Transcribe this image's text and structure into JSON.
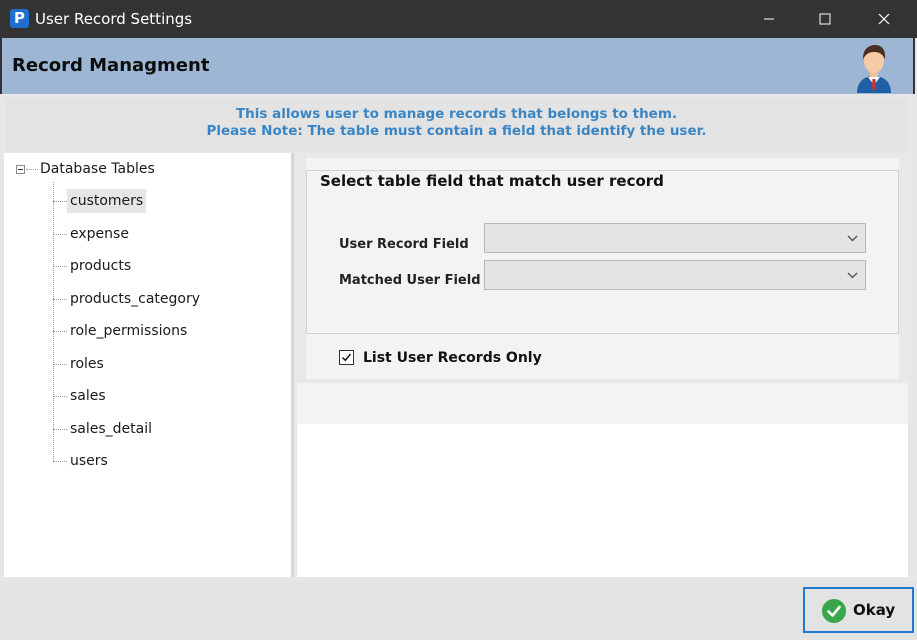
{
  "window": {
    "title": "User Record Settings",
    "app_icon_letter": "P"
  },
  "header": {
    "title": "Record Managment"
  },
  "info": {
    "line1": "This allows user to  manage records that belongs to them.",
    "line2": "Please Note: The table must contain a field that identify the user."
  },
  "tree": {
    "root_label": "Database Tables",
    "selected": "customers",
    "items": [
      {
        "label": "customers"
      },
      {
        "label": "expense"
      },
      {
        "label": "products"
      },
      {
        "label": "products_category"
      },
      {
        "label": "role_permissions"
      },
      {
        "label": "roles"
      },
      {
        "label": "sales"
      },
      {
        "label": "sales_detail"
      },
      {
        "label": "users"
      }
    ]
  },
  "settings": {
    "group_title": "Select table field that match user record",
    "user_record_field_label": "User Record Field",
    "user_record_field_value": "",
    "matched_user_field_label": "Matched User Field",
    "matched_user_field_value": "",
    "list_only_label": "List User Records Only",
    "list_only_checked": true
  },
  "footer": {
    "okay_label": "Okay"
  },
  "colors": {
    "titlebar": "#333333",
    "header_band": "#9cb6d4",
    "info_text": "#3a86c4",
    "ok_green": "#3aa64a",
    "focus_border": "#1f78d1"
  },
  "icons": {
    "app": "app-logo-icon",
    "minimize": "minimize-icon",
    "maximize": "maximize-icon",
    "close": "close-icon",
    "avatar": "user-avatar-icon",
    "dropdown": "chevron-down-icon",
    "check": "checkmark-icon",
    "ok": "ok-check-icon"
  }
}
